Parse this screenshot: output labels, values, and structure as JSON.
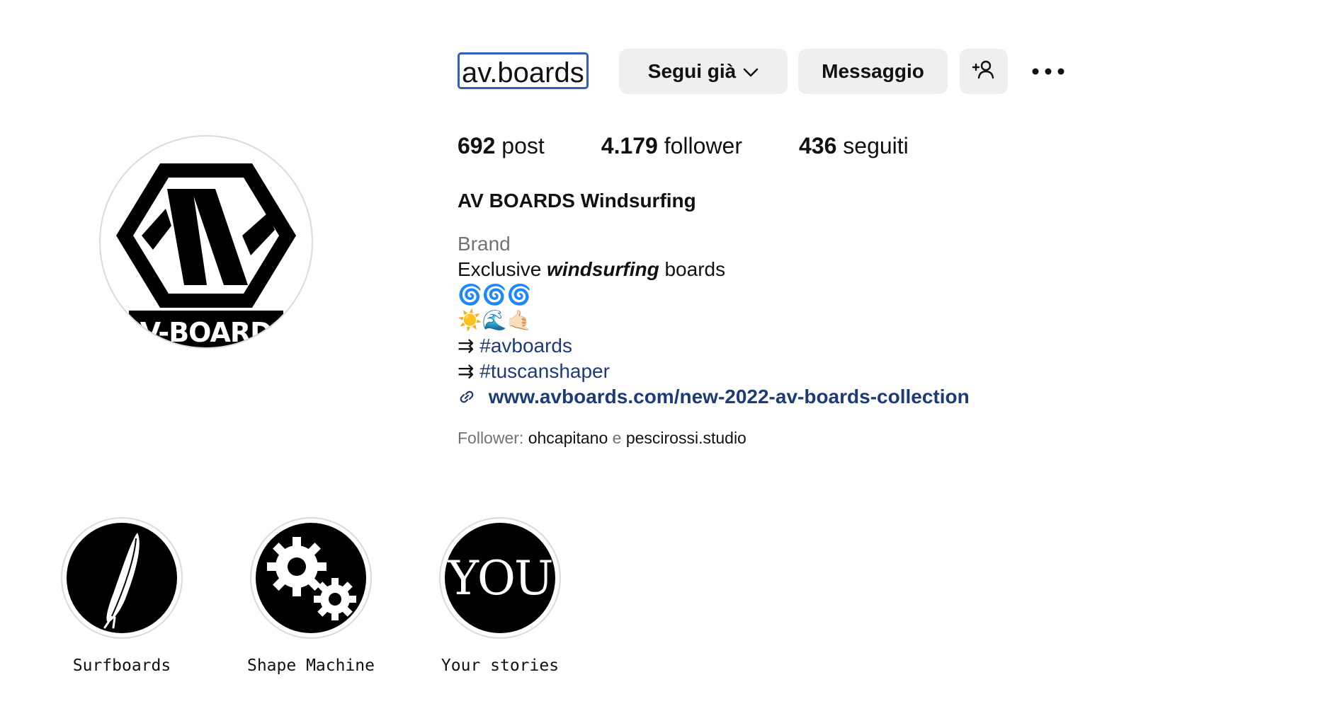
{
  "header": {
    "username": "av.boards",
    "follow_button": "Segui già",
    "message_button": "Messaggio"
  },
  "stats": {
    "posts_count": "692",
    "posts_label": "post",
    "followers_count": "4.179",
    "followers_label": "follower",
    "following_count": "436",
    "following_label": "seguiti"
  },
  "profile": {
    "full_name": "AV BOARDS Windsurfing",
    "avatar_text": "AV-BOARDS",
    "category": "Brand",
    "bio_prefix": "Exclusive",
    "bio_emph": "windsurfing",
    "bio_suffix": "boards",
    "emoji_line_1": "🌀🌀🌀",
    "emoji_line_2": "☀️🌊🤙🏻",
    "arrow": "⇉",
    "hashtag_1": "#avboards",
    "hashtag_2": "#tuscanshaper",
    "website": "www.avboards.com/new-2022-av-boards-collection"
  },
  "followed_by": {
    "label": "Follower:",
    "name_1": "ohcapitano",
    "joiner": "e",
    "name_2": "pescirossi.studio"
  },
  "highlights": [
    {
      "label": "Surfboards",
      "icon": "surfboard-icon"
    },
    {
      "label": "Shape Machine",
      "icon": "gears-icon"
    },
    {
      "label": "Your stories",
      "cover_text": "YOU"
    }
  ],
  "colors": {
    "link": "#1d3a7a",
    "button_bg": "#efefef",
    "muted": "#737373",
    "focus_outline": "#2f5fb8"
  }
}
